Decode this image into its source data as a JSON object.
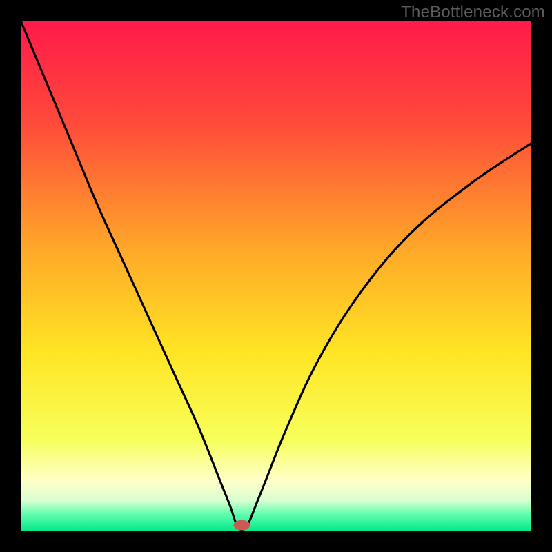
{
  "watermark": "TheBottleneck.com",
  "chart_data": {
    "type": "line",
    "title": "",
    "xlabel": "",
    "ylabel": "",
    "xlim": [
      0,
      100
    ],
    "ylim": [
      0,
      100
    ],
    "background_gradient": {
      "stops": [
        {
          "offset": 0.0,
          "color": "#ff1a4a"
        },
        {
          "offset": 0.2,
          "color": "#ff4a3a"
        },
        {
          "offset": 0.45,
          "color": "#ffa928"
        },
        {
          "offset": 0.65,
          "color": "#ffe524"
        },
        {
          "offset": 0.82,
          "color": "#f7ff5a"
        },
        {
          "offset": 0.9,
          "color": "#ffffc8"
        },
        {
          "offset": 0.94,
          "color": "#d8ffd0"
        },
        {
          "offset": 0.965,
          "color": "#64ffb0"
        },
        {
          "offset": 1.0,
          "color": "#00e888"
        }
      ]
    },
    "series": [
      {
        "name": "bottleneck-curve",
        "x": [
          0,
          5,
          10,
          15,
          20,
          25,
          30,
          35,
          39,
          41,
          42,
          42.8,
          43.8,
          44.8,
          46,
          48,
          52,
          58,
          66,
          76,
          88,
          100
        ],
        "values": [
          100,
          88,
          76,
          64,
          53,
          42,
          31,
          20,
          10,
          5,
          2,
          0.5,
          0.5,
          2,
          5,
          10,
          20,
          33,
          46,
          58,
          68,
          76
        ]
      }
    ],
    "marker": {
      "name": "minimum-marker",
      "x": 43.3,
      "y": 1.2,
      "rx": 1.6,
      "ry": 1.0,
      "color": "#cc5a52"
    }
  }
}
